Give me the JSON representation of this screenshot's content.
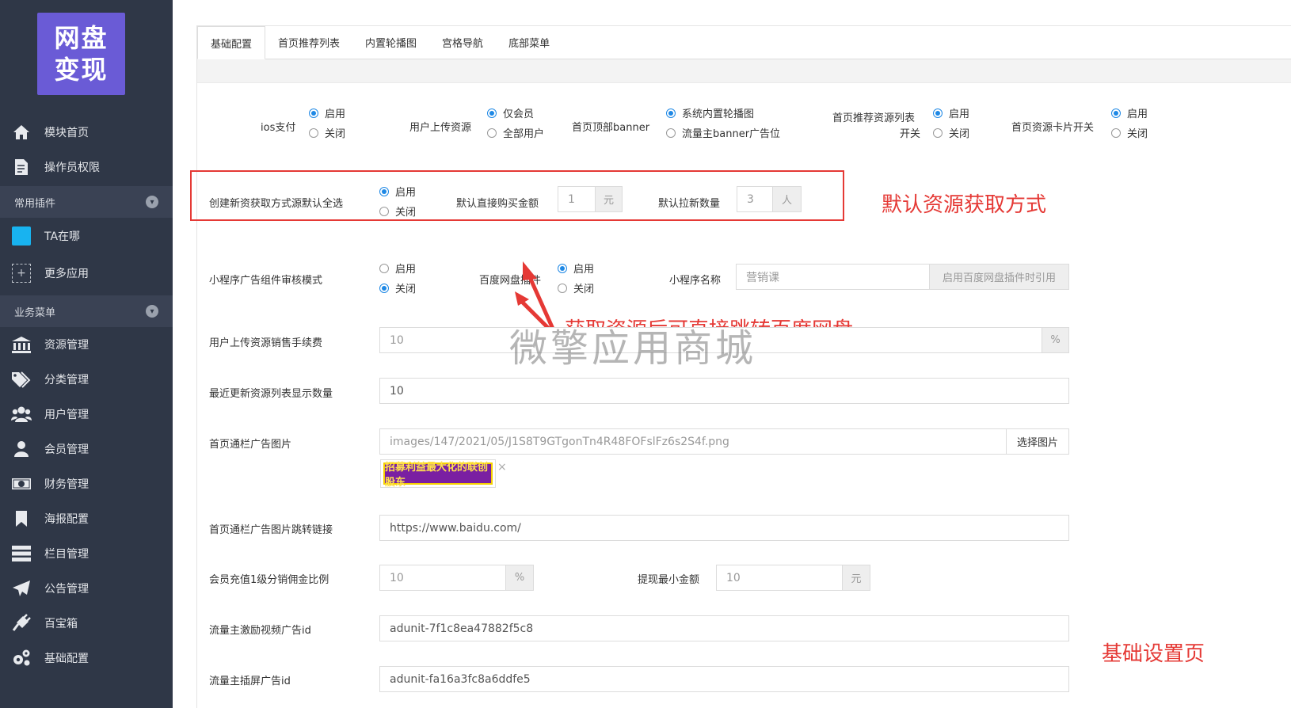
{
  "sidebar": {
    "logo_line1": "网盘",
    "logo_line2": "变现",
    "items_top": [
      {
        "label": "模块首页",
        "icon": "home-icon"
      },
      {
        "label": "操作员权限",
        "icon": "document-edit-icon"
      }
    ],
    "section_plugins": "常用插件",
    "items_plugins": [
      {
        "label": "TA在哪",
        "icon": "square-icon"
      },
      {
        "label": "更多应用",
        "icon": "plus-box-icon"
      }
    ],
    "section_business": "业务菜单",
    "items_business": [
      {
        "label": "资源管理",
        "icon": "bank-icon"
      },
      {
        "label": "分类管理",
        "icon": "tags-icon"
      },
      {
        "label": "用户管理",
        "icon": "users-icon"
      },
      {
        "label": "会员管理",
        "icon": "user-icon"
      },
      {
        "label": "财务管理",
        "icon": "money-icon"
      },
      {
        "label": "海报配置",
        "icon": "bookmark-icon"
      },
      {
        "label": "栏目管理",
        "icon": "server-icon"
      },
      {
        "label": "公告管理",
        "icon": "send-icon"
      },
      {
        "label": "百宝箱",
        "icon": "plug-icon"
      },
      {
        "label": "基础配置",
        "icon": "gears-icon"
      }
    ]
  },
  "tabs": [
    "基础配置",
    "首页推荐列表",
    "内置轮播图",
    "宫格导航",
    "底部菜单"
  ],
  "row1": {
    "ios_label": "ios支付",
    "ios_opts": [
      "启用",
      "关闭"
    ],
    "upload_label": "用户上传资源",
    "upload_opts": [
      "仅会员",
      "全部用户"
    ],
    "banner_label": "首页顶部banner",
    "banner_opts": [
      "系统内置轮播图",
      "流量主banner广告位"
    ],
    "recommend_label1": "首页推荐资源列表",
    "recommend_label2": "开关",
    "recommend_opts": [
      "启用",
      "关闭"
    ],
    "card_label": "首页资源卡片开关",
    "card_opts": [
      "启用",
      "关闭"
    ]
  },
  "row2": {
    "create_label": "创建新资获取方式源默认全选",
    "create_opts": [
      "启用",
      "关闭"
    ],
    "buy_label": "默认直接购买金额",
    "buy_value": "1",
    "buy_unit": "元",
    "invite_label": "默认拉新数量",
    "invite_value": "3",
    "invite_unit": "人"
  },
  "row3": {
    "ad_label": "小程序广告组件审核模式",
    "ad_opts": [
      "启用",
      "关闭"
    ],
    "baidu_label": "百度网盘插件",
    "baidu_opts": [
      "启用",
      "关闭"
    ],
    "mini_name_label": "小程序名称",
    "mini_name_placeholder": "营销课",
    "mini_name_hint": "启用百度网盘插件时引用"
  },
  "fee": {
    "label": "用户上传资源销售手续费",
    "value": "10",
    "unit": "%"
  },
  "recent": {
    "label": "最近更新资源列表显示数量",
    "value": "10"
  },
  "ad_image": {
    "label": "首页通栏广告图片",
    "value": "images/147/2021/05/J1S8T9GTgonTn4R48FOFslFz6s2S4f.png",
    "button": "选择图片",
    "thumb_text": "招募利益最大化的联创股东",
    "remove": "×"
  },
  "ad_link": {
    "label": "首页通栏广告图片跳转链接",
    "value": "https://www.baidu.com/"
  },
  "commission": {
    "label": "会员充值1级分销佣金比例",
    "value": "10",
    "unit": "%",
    "withdraw_label": "提现最小金额",
    "withdraw_value": "10",
    "withdraw_unit": "元"
  },
  "video_ad": {
    "label": "流量主激励视频广告id",
    "value": "adunit-7f1c8ea47882f5c8"
  },
  "insert_ad": {
    "label": "流量主插屏广告id",
    "value": "adunit-fa16a3fc8a6ddfe5"
  },
  "annotations": {
    "box_note": "默认资源获取方式",
    "arrow_note": "获取资源后可直接跳转百度网盘",
    "page_note": "基础设置页",
    "watermark": "微擎应用商城"
  },
  "colors": {
    "sidebar": "#2f3747",
    "accent": "#1e88e5",
    "annotation": "#e53935"
  }
}
